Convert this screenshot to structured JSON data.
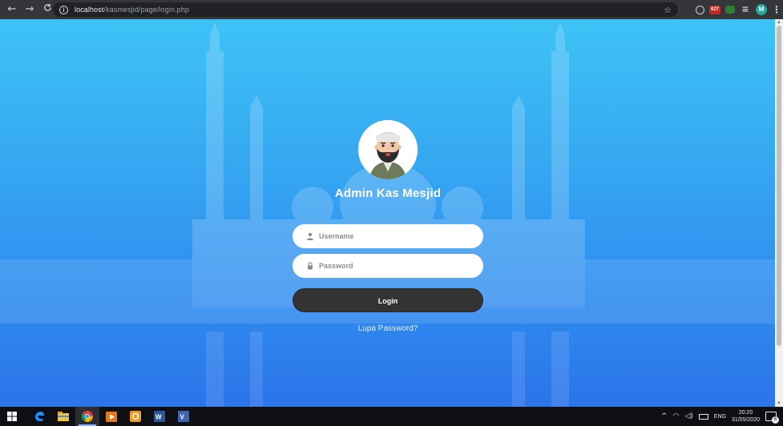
{
  "browser": {
    "url_host": "localhost",
    "url_path": "/kasmesjid/page/login.php",
    "back_glyph": "←",
    "forward_glyph": "→",
    "reload_glyph": "C",
    "star_glyph": "☆",
    "extension_badge": "627",
    "profile_initial": "M",
    "menu_glyph": "⋮"
  },
  "login": {
    "title": "Admin Kas Mesjid",
    "username_placeholder": "Username",
    "password_placeholder": "Password",
    "login_label": "Login",
    "forgot_label": "Lupa Password?"
  },
  "taskbar": {
    "language": "ENG",
    "time": "20:20",
    "date": "31/05/2020",
    "notification_count": "6"
  },
  "colors": {
    "accent_gradient_top": "#3ec3f5",
    "accent_gradient_bottom": "#2c74ea",
    "button": "#333333",
    "browser_chrome": "#35363a"
  },
  "icons": [
    "back-icon",
    "forward-icon",
    "reload-icon",
    "info-icon",
    "star-icon",
    "user-icon",
    "lock-icon",
    "windows-start-icon",
    "edge-icon",
    "file-explorer-icon",
    "chrome-icon",
    "media-player-icon",
    "orange-app-icon",
    "word-icon",
    "vs-icon"
  ]
}
